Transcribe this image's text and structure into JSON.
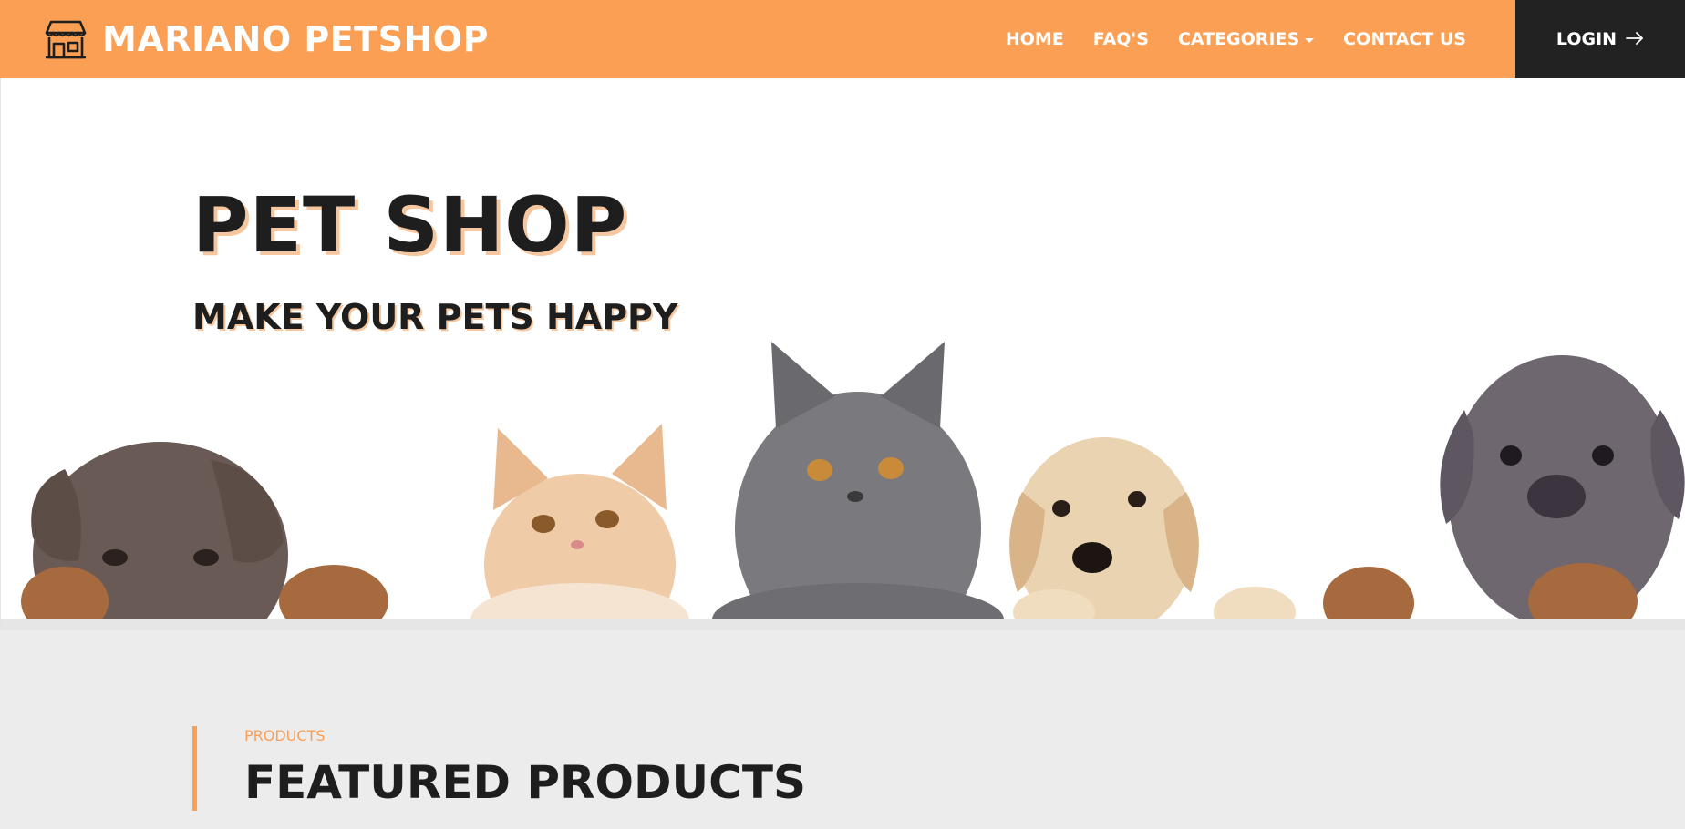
{
  "navbar": {
    "brand": "MARIANO PETSHOP",
    "brand_icon": "store-icon",
    "links": [
      {
        "label": "HOME"
      },
      {
        "label": "FAQ'S"
      },
      {
        "label": "CATEGORIES",
        "dropdown": true
      },
      {
        "label": "CONTACT US"
      }
    ],
    "login_label": "LOGIN",
    "login_icon": "arrow-right-icon"
  },
  "hero": {
    "title": "PET SHOP",
    "subtitle": "MAKE YOUR PETS HAPPY",
    "image_subjects": [
      "puppy-doberman-brown",
      "kitten-ginger",
      "kitten-grey",
      "puppy-golden",
      "puppy-doberman-grey"
    ]
  },
  "products": {
    "kicker": "PRODUCTS",
    "title": "FEATURED PRODUCTS"
  },
  "colors": {
    "accent": "#fb9f54",
    "dark": "#222222",
    "section_bg": "#ececed",
    "title_shadow": "#f6c79e"
  }
}
